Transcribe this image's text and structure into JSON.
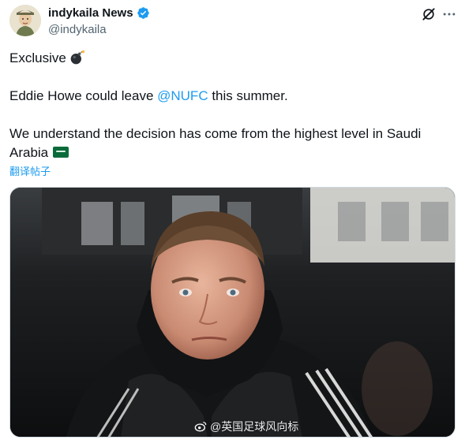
{
  "author": {
    "display_name": "indykaila News",
    "handle": "@indykaila",
    "verified_color": "#1d9bf0"
  },
  "header_icons": {
    "grok": "grok-icon",
    "more": "more-icon"
  },
  "tweet": {
    "line1": "Exclusive",
    "line1_emoji": "bomb-emoji",
    "line2_before": "Eddie Howe could leave ",
    "line2_mention": "@NUFC",
    "line2_after": " this summer.",
    "line3": "We understand the decision has come from the highest level in Saudi",
    "line4": "Arabia",
    "line4_emoji": "saudi-flag-emoji"
  },
  "translate_link": "翻译帖子",
  "media": {
    "watermark": "@英国足球风向标"
  },
  "colors": {
    "text": "#0f1419",
    "secondary": "#536471",
    "link": "#1d9bf0"
  }
}
